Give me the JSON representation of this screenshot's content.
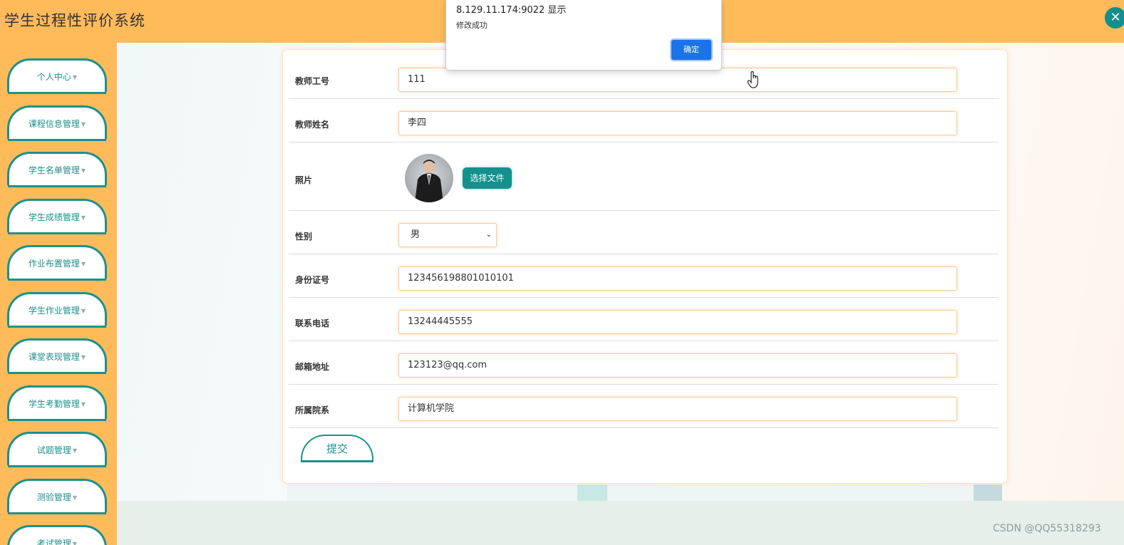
{
  "header": {
    "title": "学生过程性评价系统",
    "close_icon": "close-icon"
  },
  "sidebar": {
    "items": [
      {
        "label": "个人中心"
      },
      {
        "label": "课程信息管理"
      },
      {
        "label": "学生名单管理"
      },
      {
        "label": "学生成绩管理"
      },
      {
        "label": "作业布置管理"
      },
      {
        "label": "学生作业管理"
      },
      {
        "label": "课堂表现管理"
      },
      {
        "label": "学生考勤管理"
      },
      {
        "label": "试题管理"
      },
      {
        "label": "测验管理"
      },
      {
        "label": "考试管理"
      }
    ]
  },
  "form": {
    "fields": {
      "teacher_id": {
        "label": "教师工号",
        "value": "111"
      },
      "teacher_name": {
        "label": "教师姓名",
        "value": "李四"
      },
      "photo": {
        "label": "照片",
        "button": "选择文件"
      },
      "gender": {
        "label": "性别",
        "value": "男"
      },
      "id_number": {
        "label": "身份证号",
        "value": "123456198801010101"
      },
      "phone": {
        "label": "联系电话",
        "value": "13244445555"
      },
      "email": {
        "label": "邮箱地址",
        "value": "123123@qq.com"
      },
      "department": {
        "label": "所属院系",
        "value": "计算机学院"
      }
    },
    "submit_label": "提交"
  },
  "alert": {
    "title": "8.129.11.174:9022 显示",
    "message": "修改成功",
    "ok_label": "确定"
  },
  "watermark": "CSDN @QQ55318293",
  "colors": {
    "header": "#ffbb5a",
    "accent": "#1b918c",
    "ok_button": "#1a73e8"
  }
}
